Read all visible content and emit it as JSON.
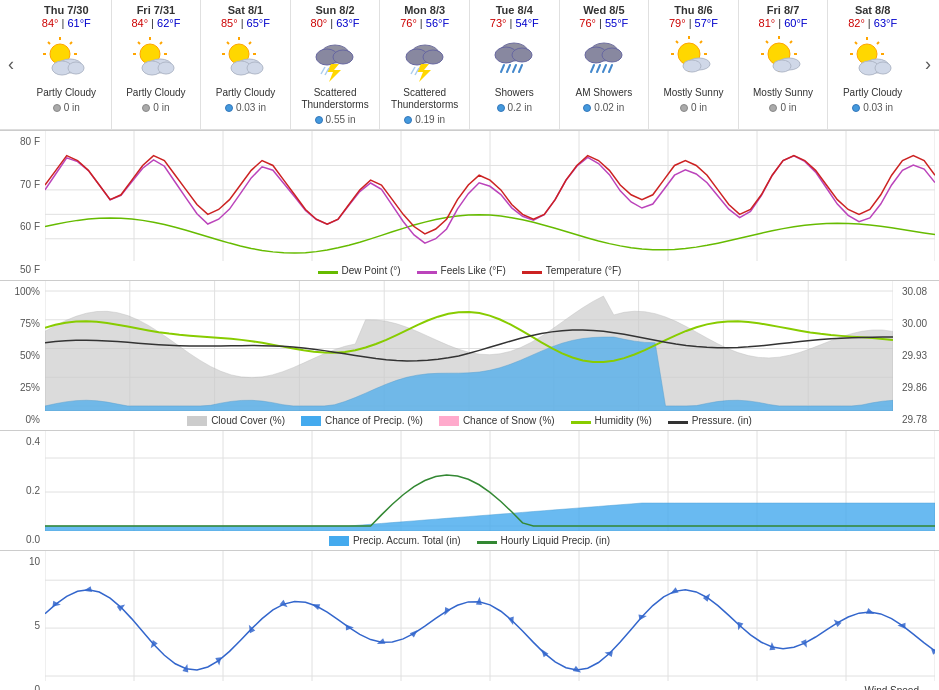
{
  "nav": {
    "prev_label": "‹",
    "next_label": "›"
  },
  "days": [
    {
      "id": "thu-7-30",
      "name": "Thu 7/30",
      "high": "84°",
      "low": "61°F",
      "condition": "Partly Cloudy",
      "precip": "0 in",
      "precip_type": "gray",
      "icon": "partly_cloudy"
    },
    {
      "id": "fri-7-31",
      "name": "Fri 7/31",
      "high": "84°",
      "low": "62°F",
      "condition": "Partly Cloudy",
      "precip": "0 in",
      "precip_type": "gray",
      "icon": "partly_cloudy"
    },
    {
      "id": "sat-8-1",
      "name": "Sat 8/1",
      "high": "85°",
      "low": "65°F",
      "condition": "Partly Cloudy",
      "precip": "0.03 in",
      "precip_type": "blue",
      "icon": "partly_cloudy"
    },
    {
      "id": "sun-8-2",
      "name": "Sun 8/2",
      "high": "80°",
      "low": "63°F",
      "condition": "Scattered Thunderstorms",
      "precip": "0.55 in",
      "precip_type": "blue",
      "icon": "thunderstorm"
    },
    {
      "id": "mon-8-3",
      "name": "Mon 8/3",
      "high": "76°",
      "low": "56°F",
      "condition": "Scattered Thunderstorms",
      "precip": "0.19 in",
      "precip_type": "blue",
      "icon": "thunderstorm"
    },
    {
      "id": "tue-8-4",
      "name": "Tue 8/4",
      "high": "73°",
      "low": "54°F",
      "condition": "Showers",
      "precip": "0.2 in",
      "precip_type": "blue",
      "icon": "showers"
    },
    {
      "id": "wed-8-5",
      "name": "Wed 8/5",
      "high": "76°",
      "low": "55°F",
      "condition": "AM Showers",
      "precip": "0.02 in",
      "precip_type": "blue",
      "icon": "showers"
    },
    {
      "id": "thu-8-6",
      "name": "Thu 8/6",
      "high": "79°",
      "low": "57°F",
      "condition": "Mostly Sunny",
      "precip": "0 in",
      "precip_type": "gray",
      "icon": "mostly_sunny"
    },
    {
      "id": "fri-8-7",
      "name": "Fri 8/7",
      "high": "81°",
      "low": "60°F",
      "condition": "Mostly Sunny",
      "precip": "0 in",
      "precip_type": "gray",
      "icon": "mostly_sunny"
    },
    {
      "id": "sat-8-8",
      "name": "Sat 8/8",
      "high": "82°",
      "low": "63°F",
      "condition": "Partly Cloudy",
      "precip": "0.03 in",
      "precip_type": "blue",
      "icon": "partly_cloudy"
    }
  ],
  "chart1": {
    "y_labels": [
      "80 F",
      "70 F",
      "60 F",
      "50 F"
    ],
    "legend": [
      {
        "label": "Dew Point (°)",
        "color": "#66bb00",
        "type": "line"
      },
      {
        "label": "Feels Like (°F)",
        "color": "#bb44bb",
        "type": "line"
      },
      {
        "label": "Temperature (°F)",
        "color": "#cc2222",
        "type": "line"
      }
    ]
  },
  "chart2": {
    "y_labels": [
      "100%",
      "75%",
      "50%",
      "25%",
      "0%"
    ],
    "y_labels_right": [
      "30.08",
      "30.00",
      "29.93",
      "29.86",
      "29.78"
    ],
    "legend": [
      {
        "label": "Cloud Cover (%)",
        "color": "#cccccc",
        "type": "area"
      },
      {
        "label": "Chance of Precip. (%)",
        "color": "#44aaee",
        "type": "area"
      },
      {
        "label": "Chance of Snow (%)",
        "color": "#ffaacc",
        "type": "area"
      },
      {
        "label": "Humidity (%)",
        "color": "#88cc00",
        "type": "line"
      },
      {
        "label": "Pressure. (in)",
        "color": "#333333",
        "type": "line"
      }
    ]
  },
  "chart3": {
    "y_labels": [
      "0.4",
      "0.2",
      "0.0"
    ],
    "legend": [
      {
        "label": "Precip. Accum. Total (in)",
        "color": "#44aaee",
        "type": "area"
      },
      {
        "label": "Hourly Liquid Precip. (in)",
        "color": "#338833",
        "type": "line"
      }
    ]
  },
  "chart4": {
    "y_labels": [
      "10",
      "5",
      "0"
    ],
    "legend": [
      {
        "label": "Wind Speed",
        "color": "#3366cc",
        "type": "line"
      }
    ],
    "footer": "→"
  }
}
